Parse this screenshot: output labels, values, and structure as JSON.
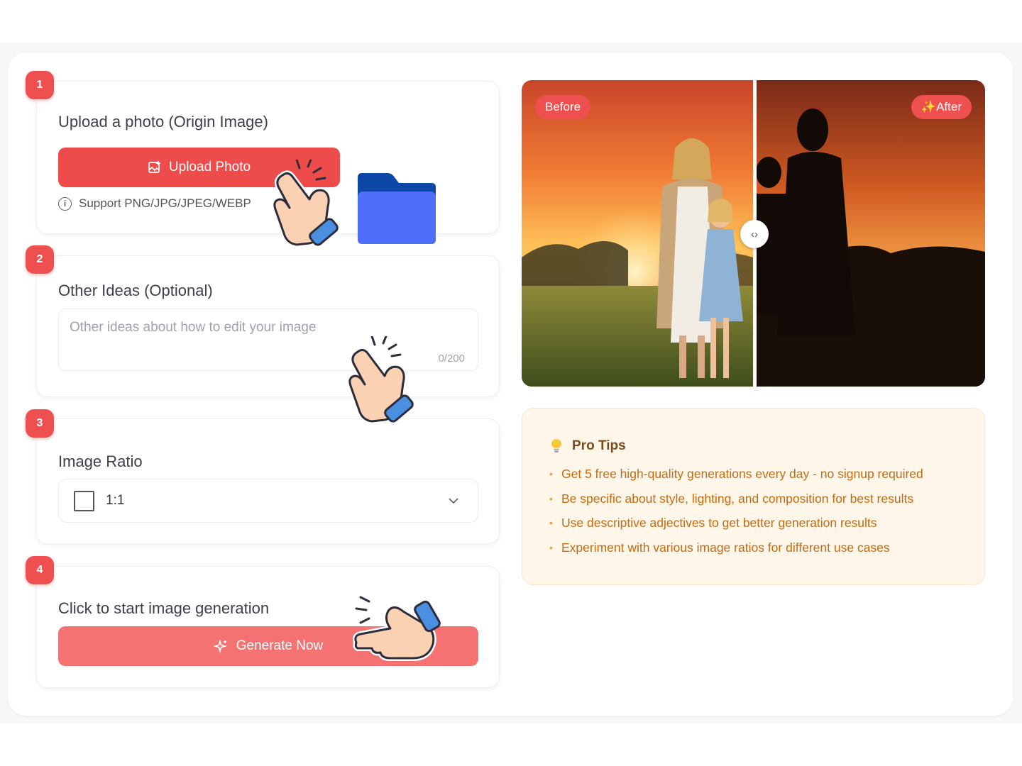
{
  "steps": {
    "s1": {
      "number": "1",
      "title": "Upload a photo (Origin Image)",
      "button_label": "Upload Photo",
      "support_text": "Support PNG/JPG/JPEG/WEBP"
    },
    "s2": {
      "number": "2",
      "title": "Other Ideas (Optional)",
      "placeholder": "Other ideas about how to edit your image",
      "counter": "0/200"
    },
    "s3": {
      "number": "3",
      "title": "Image Ratio",
      "selected": "1:1"
    },
    "s4": {
      "number": "4",
      "title": "Click to start image generation",
      "button_label": "Generate Now"
    }
  },
  "preview": {
    "before_label": "Before",
    "after_label": "✨After"
  },
  "tips": {
    "title": "Pro Tips",
    "items": [
      "Get 5 free high-quality generations every day - no signup required",
      "Be specific about style, lighting, and composition for best results",
      "Use descriptive adjectives to get better generation results",
      "Experiment with various image ratios for different use cases"
    ]
  },
  "colors": {
    "accent": "#ee4b4b",
    "generate": "#f47272",
    "tips_bg": "#fff6ea",
    "tips_text": "#c46a12",
    "folder": "#4f6ef7"
  },
  "icons": [
    "image-upload-icon",
    "info-icon",
    "chevron-down-icon",
    "sparkle-icon",
    "lightbulb-icon",
    "pointing-hand-icon",
    "folder-icon",
    "compare-arrows-icon"
  ]
}
